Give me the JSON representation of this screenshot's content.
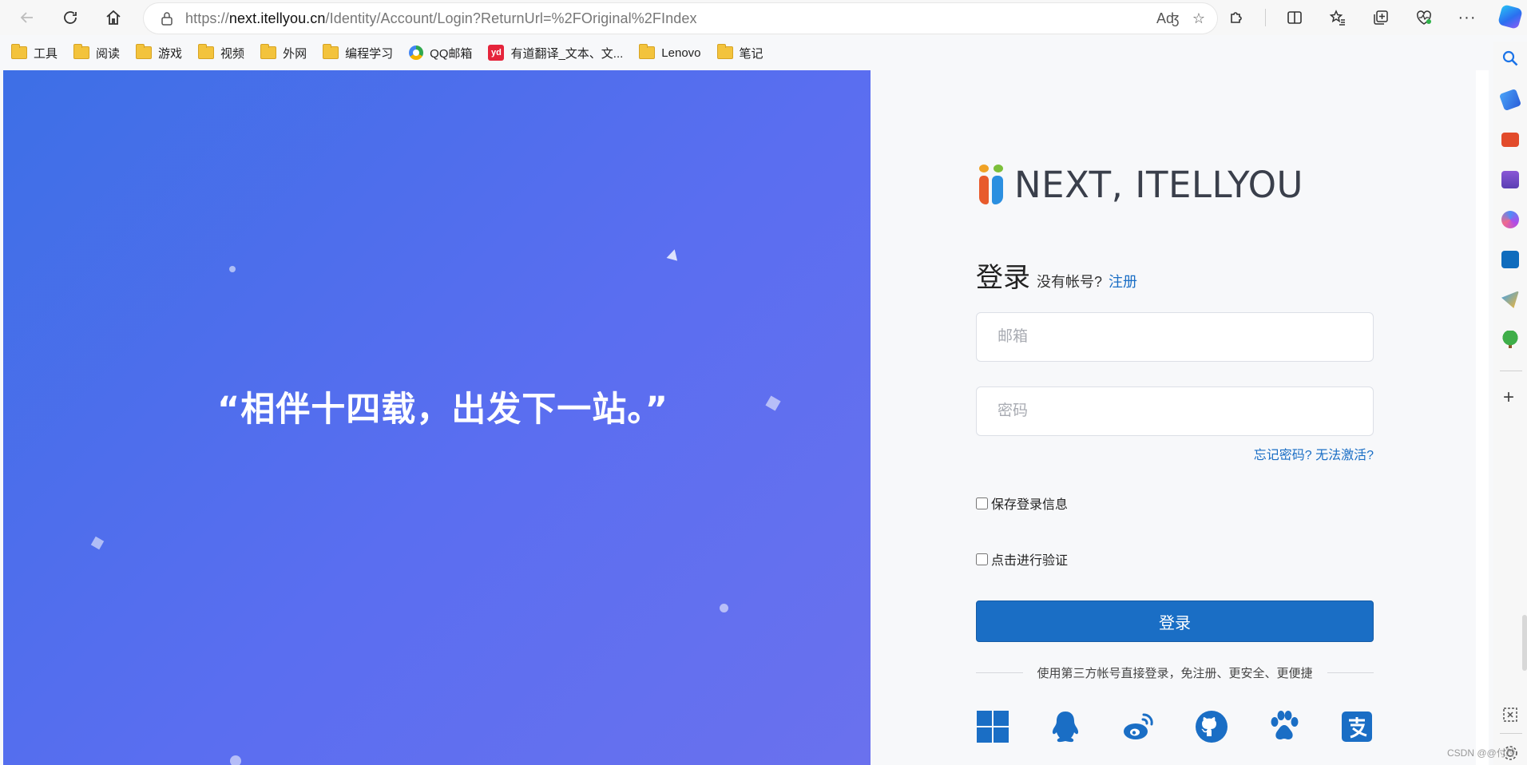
{
  "browser": {
    "url_prefix": "https://",
    "url_host": "next.itellyou.cn",
    "url_path": "/Identity/Account/Login?ReturnUrl=%2FOriginal%2FIndex",
    "read_aloud_icon": "Aʤ",
    "bookmarks": [
      {
        "label": "工具",
        "icon": "folder-icon"
      },
      {
        "label": "阅读",
        "icon": "folder-icon"
      },
      {
        "label": "游戏",
        "icon": "folder-icon"
      },
      {
        "label": "视频",
        "icon": "folder-icon"
      },
      {
        "label": "外网",
        "icon": "folder-icon"
      },
      {
        "label": "编程学习",
        "icon": "folder-icon"
      },
      {
        "label": "QQ邮箱",
        "icon": "qq-mail-icon"
      },
      {
        "label": "有道翻译_文本、文...",
        "icon": "youdao-icon"
      },
      {
        "label": "Lenovo",
        "icon": "folder-icon"
      },
      {
        "label": "笔记",
        "icon": "folder-icon"
      }
    ],
    "youdao_badge": "yd"
  },
  "hero": {
    "quote": "“相伴十四载，出发下一站。”"
  },
  "login": {
    "logo_text": "NEXT, ITELLYOU",
    "title": "登录",
    "no_account": "没有帐号?",
    "register_link": "注册",
    "email_placeholder": "邮箱",
    "password_placeholder": "密码",
    "forgot_link": "忘记密码? 无法激活?",
    "remember_label": "保存登录信息",
    "verify_label": "点击进行验证",
    "submit_label": "登录",
    "third_party_text": "使用第三方帐号直接登录，免注册、更安全、更便捷",
    "third_party": [
      "windows-icon",
      "qq-icon",
      "weibo-icon",
      "github-icon",
      "baidu-icon",
      "alipay-icon"
    ]
  },
  "colors": {
    "accent": "#1a6ec5",
    "hero_start": "#3d6fe6",
    "hero_end": "#6a71ee"
  },
  "watermark": "CSDN @@付玲"
}
